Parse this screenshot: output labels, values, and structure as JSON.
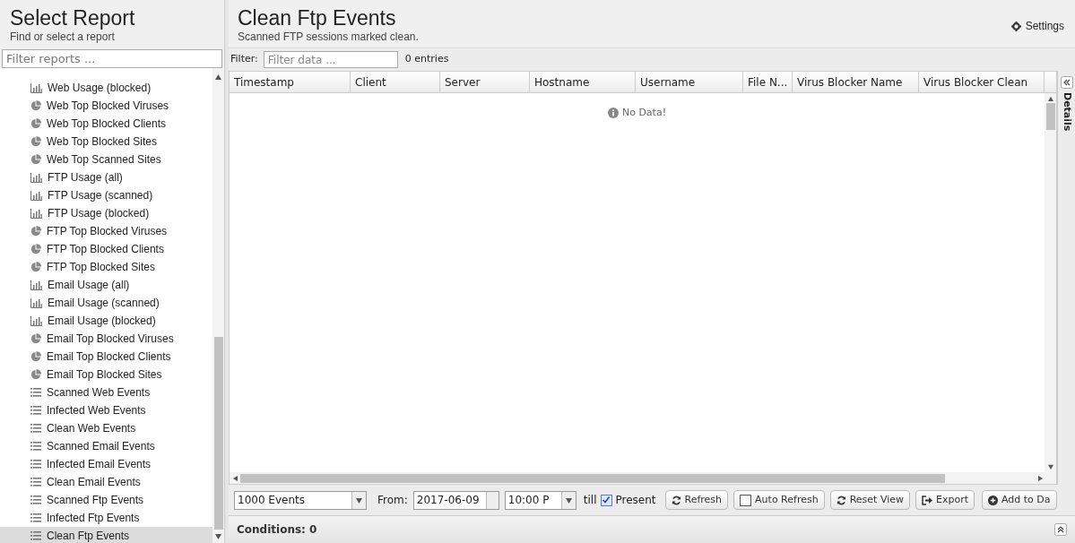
{
  "sidebar": {
    "title": "Select Report",
    "subtitle": "Find or select a report",
    "filter": {
      "placeholder": "Filter reports ..."
    },
    "items": [
      {
        "kind": "bar",
        "label": "Web Usage (blocked)",
        "selected": false
      },
      {
        "kind": "pie",
        "label": "Web Top Blocked Viruses",
        "selected": false
      },
      {
        "kind": "pie",
        "label": "Web Top Blocked Clients",
        "selected": false
      },
      {
        "kind": "pie",
        "label": "Web Top Blocked Sites",
        "selected": false
      },
      {
        "kind": "pie",
        "label": "Web Top Scanned Sites",
        "selected": false
      },
      {
        "kind": "bar",
        "label": "FTP Usage (all)",
        "selected": false
      },
      {
        "kind": "bar",
        "label": "FTP Usage (scanned)",
        "selected": false
      },
      {
        "kind": "bar",
        "label": "FTP Usage (blocked)",
        "selected": false
      },
      {
        "kind": "pie",
        "label": "FTP Top Blocked Viruses",
        "selected": false
      },
      {
        "kind": "pie",
        "label": "FTP Top Blocked Clients",
        "selected": false
      },
      {
        "kind": "pie",
        "label": "FTP Top Blocked Sites",
        "selected": false
      },
      {
        "kind": "bar",
        "label": "Email Usage (all)",
        "selected": false
      },
      {
        "kind": "bar",
        "label": "Email Usage (scanned)",
        "selected": false
      },
      {
        "kind": "bar",
        "label": "Email Usage (blocked)",
        "selected": false
      },
      {
        "kind": "pie",
        "label": "Email Top Blocked Viruses",
        "selected": false
      },
      {
        "kind": "pie",
        "label": "Email Top Blocked Clients",
        "selected": false
      },
      {
        "kind": "pie",
        "label": "Email Top Blocked Sites",
        "selected": false
      },
      {
        "kind": "list",
        "label": "Scanned Web Events",
        "selected": false
      },
      {
        "kind": "list",
        "label": "Infected Web Events",
        "selected": false
      },
      {
        "kind": "list",
        "label": "Clean Web Events",
        "selected": false
      },
      {
        "kind": "list",
        "label": "Scanned Email Events",
        "selected": false
      },
      {
        "kind": "list",
        "label": "Infected Email Events",
        "selected": false
      },
      {
        "kind": "list",
        "label": "Clean Email Events",
        "selected": false
      },
      {
        "kind": "list",
        "label": "Scanned Ftp Events",
        "selected": false
      },
      {
        "kind": "list",
        "label": "Infected Ftp Events",
        "selected": false
      },
      {
        "kind": "list",
        "label": "Clean Ftp Events",
        "selected": true
      }
    ]
  },
  "report": {
    "title": "Clean Ftp Events",
    "subtitle": "Scanned FTP sessions marked clean.",
    "settings": "Settings",
    "filter_label": "Filter:",
    "filter": {
      "placeholder": "Filter data ..."
    },
    "entries": "0 entries",
    "table": {
      "columns": [
        "Timestamp",
        "Client",
        "Server",
        "Hostname",
        "Username",
        "File N...",
        "Virus Blocker Name",
        "Virus Blocker Clean"
      ],
      "empty": "No Data!"
    },
    "details": "Details",
    "toolbar": {
      "limit": "1000 Events",
      "from_label": "From:",
      "date": "2017-06-09",
      "time": "10:00 P",
      "till": "till",
      "present": {
        "label": "Present",
        "checked": true
      },
      "refresh": "Refresh",
      "auto_refresh": {
        "label": "Auto Refresh",
        "checked": false
      },
      "reset_view": "Reset View",
      "export": "Export",
      "add": "Add to Da"
    },
    "conditions": "Conditions: 0"
  }
}
